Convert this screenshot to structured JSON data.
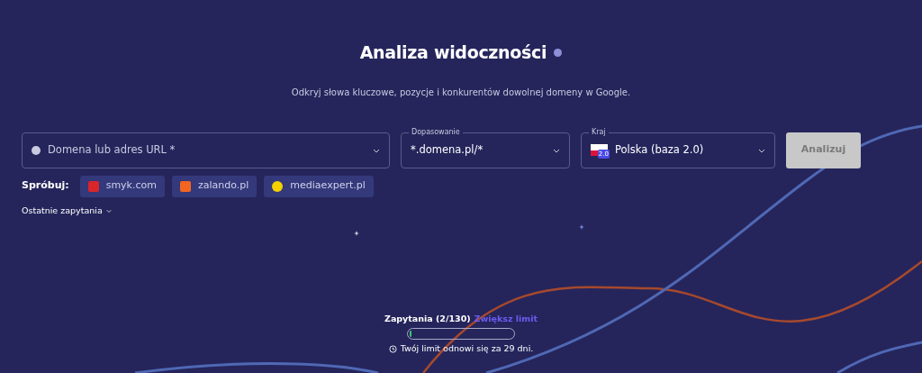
{
  "header": {
    "title": "Analiza widoczności",
    "subtitle": "Odkryj słowa kluczowe, pozycje i konkurentów dowolnej domeny w Google."
  },
  "form": {
    "domain": {
      "placeholder": "Domena lub adres URL *"
    },
    "match": {
      "label": "Dopasowanie",
      "value": "*.domena.pl/*"
    },
    "country": {
      "label": "Kraj",
      "value": "Polska (baza 2.0)",
      "badge": "2.0"
    },
    "submit": {
      "label": "Analizuj",
      "disabled": true
    }
  },
  "try": {
    "label": "Spróbuj:",
    "sites": [
      {
        "name": "smyk.com",
        "color": "#d8262b"
      },
      {
        "name": "zalando.pl",
        "color": "#f26522"
      },
      {
        "name": "mediaexpert.pl",
        "color": "#f5d000"
      }
    ]
  },
  "recent": {
    "label": "Ostatnie zapytania",
    "expanded": false
  },
  "quota": {
    "label": "Zapytania (2/130)",
    "link": "Zwiększ limit",
    "level": 0.015,
    "renew": "Twój limit odnowi się za 29 dni."
  }
}
